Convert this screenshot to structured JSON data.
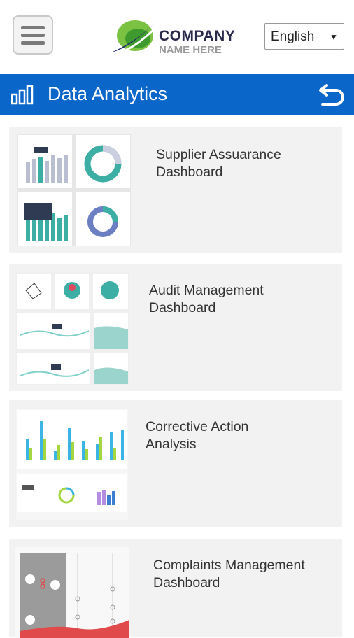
{
  "topbar": {
    "menu_icon": "hamburger-menu-icon",
    "logo": {
      "line1": "COMPANY",
      "line2": "NAME HERE"
    },
    "language": {
      "selected": "English",
      "arrow": "▼"
    }
  },
  "header": {
    "title": "Data Analytics",
    "left_icon": "bar-chart-icon",
    "right_icon": "back-arrow-icon",
    "color": "#0a66c9"
  },
  "cards": [
    {
      "title": "Supplier Assuarance Dashboard"
    },
    {
      "title": "Audit Management Dashboard"
    },
    {
      "title": "Corrective Action Analysis"
    },
    {
      "title": "Complaints Management Dashboard"
    }
  ]
}
